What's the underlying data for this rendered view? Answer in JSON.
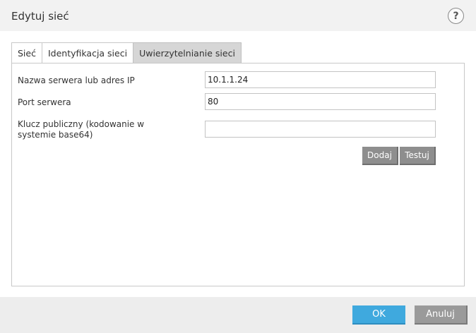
{
  "window": {
    "title": "Edytuj sieć",
    "help_glyph": "?"
  },
  "tabs": [
    {
      "label": "Sieć",
      "active": false
    },
    {
      "label": "Identyfikacja sieci",
      "active": false
    },
    {
      "label": "Uwierzytelnianie sieci",
      "active": true
    }
  ],
  "form": {
    "server": {
      "label": "Nazwa serwera lub adres IP",
      "value": "10.1.1.24"
    },
    "port": {
      "label": "Port serwera",
      "value": "80"
    },
    "public_key": {
      "label": "Klucz publiczny (kodowanie w systemie base64)",
      "value": ""
    },
    "add_label": "Dodaj",
    "test_label": "Testuj"
  },
  "footer": {
    "ok_label": "OK",
    "cancel_label": "Anuluj"
  },
  "colors": {
    "accent": "#3fa9de",
    "button_gray": "#8e8e8e",
    "active_tab": "#d6d6d6"
  }
}
